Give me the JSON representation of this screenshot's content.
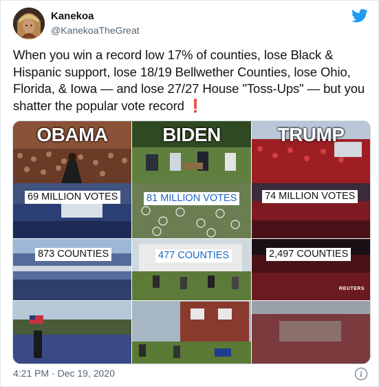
{
  "tweet": {
    "author_name": "Kanekoa",
    "author_handle": "@KanekoaTheGreat",
    "text": "When you win a record low 17% of counties, lose Black & Hispanic support, lose 18/19 Bellwether Counties, lose Ohio, Florida, & Iowa — and lose 27/27 House \"Toss-Ups\" — but you shatter the popular vote record ",
    "emoji": "❗",
    "timestamp": "4:21 PM · Dec 19, 2020",
    "icons": {
      "logo": "twitter-bird-icon",
      "info": "info-icon"
    },
    "colors": {
      "brand": "#1d9bf0",
      "text": "#0f1419",
      "muted": "#536471"
    }
  },
  "infographic": {
    "columns": [
      {
        "candidate": "OBAMA",
        "votes": "69 MILLION VOTES",
        "counties": "873 COUNTIES",
        "votes_color": "#111111",
        "counties_color": "#111111"
      },
      {
        "candidate": "BIDEN",
        "votes": "81 MILLION VOTES",
        "counties": "477 COUNTIES",
        "votes_color": "#1b63c6",
        "counties_color": "#1b63c6"
      },
      {
        "candidate": "TRUMP",
        "votes": "74 MILLION VOTES",
        "counties": "2,497 COUNTIES",
        "votes_color": "#111111",
        "counties_color": "#111111"
      }
    ],
    "photo_credit": "REUTERS"
  }
}
